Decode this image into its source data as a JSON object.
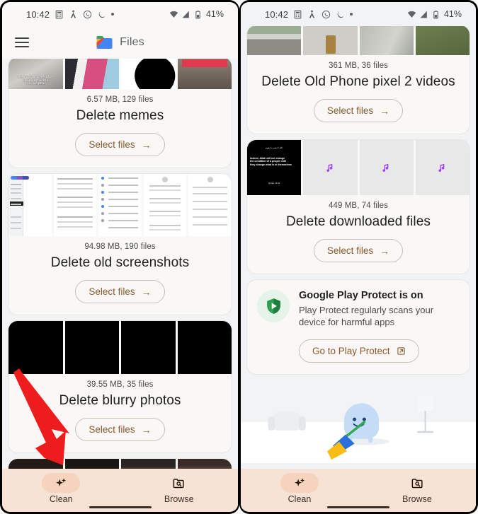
{
  "status_bar": {
    "time": "10:42",
    "battery": "41%",
    "icons": [
      "calculator-icon",
      "person-walking-icon",
      "whatsapp-icon",
      "crescent-moon-icon",
      "dot-icon"
    ],
    "right_icons": [
      "wifi-icon",
      "signal-icon",
      "battery-icon"
    ]
  },
  "app_bar": {
    "menu_icon": "hamburger-menu-icon",
    "logo": "files-app-logo",
    "title": "Files"
  },
  "left_phone": {
    "cards": [
      {
        "meta": "6.57 MB, 129 files",
        "title": "Delete memes",
        "button": "Select files",
        "thumbs": [
          "meme-thumbnail-1",
          "meme-thumbnail-2",
          "meme-thumbnail-3",
          "meme-thumbnail-4"
        ]
      },
      {
        "meta": "94.98 MB, 190 files",
        "title": "Delete old screenshots",
        "button": "Select files",
        "thumbs": [
          "screenshot-thumbnail-1",
          "screenshot-thumbnail-2",
          "screenshot-thumbnail-3",
          "screenshot-thumbnail-4",
          "screenshot-thumbnail-5"
        ]
      },
      {
        "meta": "39.55 MB, 35 files",
        "title": "Delete blurry photos",
        "button": "Select files",
        "thumbs": [
          "blurry-thumbnail-1",
          "blurry-thumbnail-2",
          "blurry-thumbnail-3",
          "blurry-thumbnail-4"
        ]
      }
    ]
  },
  "right_phone": {
    "cards": [
      {
        "meta": "361 MB, 36 files",
        "title": "Delete Old Phone pixel 2 videos",
        "button": "Select files",
        "thumbs": [
          "video-thumbnail-1",
          "video-thumbnail-2",
          "video-thumbnail-3",
          "video-thumbnail-4"
        ]
      },
      {
        "meta": "449 MB, 74 files",
        "title": "Delete downloaded files",
        "button": "Select files",
        "thumbs": [
          "quote-image-thumbnail",
          "audio-file-thumbnail",
          "audio-file-thumbnail",
          "audio-file-thumbnail"
        ]
      }
    ],
    "play_protect": {
      "icon": "play-protect-shield-icon",
      "title": "Google Play Protect is on",
      "description": "Play Protect regularly scans your device for harmful apps",
      "button": "Go to Play Protect",
      "button_icon": "external-link-icon"
    },
    "illustration": "cleaning-mascot-illustration"
  },
  "bottom_nav": {
    "items": [
      {
        "label": "Clean",
        "icon": "sparkle-icon",
        "active": true
      },
      {
        "label": "Browse",
        "icon": "folder-search-icon",
        "active": false
      }
    ]
  },
  "annotation": {
    "arrow": "red-pointer-arrow",
    "color": "#ee1c1c"
  },
  "colors": {
    "accent": "#8a5a2b",
    "nav_bg": "#f7e2d6",
    "card_bg": "#faf8f6",
    "screen_bg": "#f1f3f4"
  }
}
